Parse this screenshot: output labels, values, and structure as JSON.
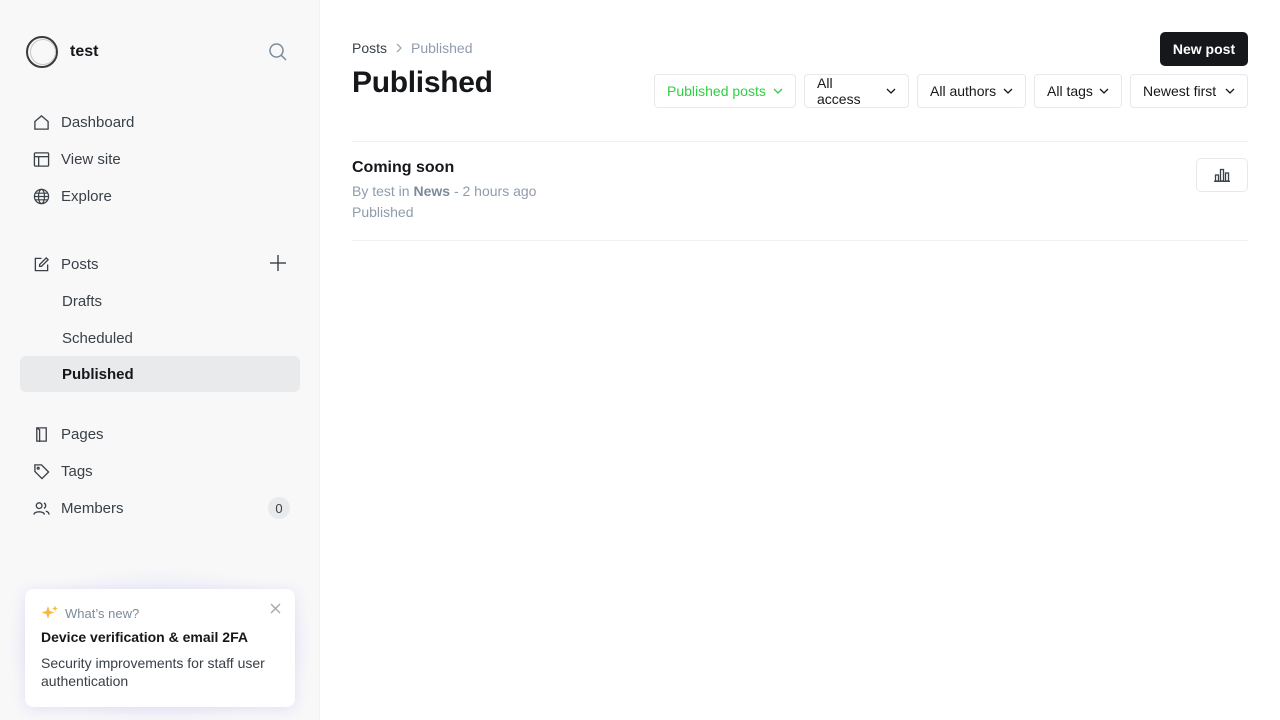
{
  "site": {
    "name": "test"
  },
  "sidebar": {
    "nav": [
      {
        "label": "Dashboard",
        "icon": "home-icon"
      },
      {
        "label": "View site",
        "icon": "layout-icon"
      },
      {
        "label": "Explore",
        "icon": "globe-icon"
      }
    ],
    "posts": {
      "label": "Posts",
      "icon": "edit-icon"
    },
    "post_subs": [
      {
        "label": "Drafts"
      },
      {
        "label": "Scheduled"
      },
      {
        "label": "Published",
        "active": true
      }
    ],
    "secondary": [
      {
        "label": "Pages",
        "icon": "page-icon"
      },
      {
        "label": "Tags",
        "icon": "tag-icon"
      },
      {
        "label": "Members",
        "icon": "members-icon",
        "count": "0"
      }
    ]
  },
  "whats_new": {
    "heading": "What’s new?",
    "title": "Device verification & email 2FA",
    "body": "Security improvements for staff user authentication"
  },
  "main": {
    "breadcrumb": {
      "parent": "Posts",
      "current": "Published"
    },
    "title": "Published",
    "new_post_label": "New post",
    "filters": {
      "type": "Published posts",
      "access": "All access",
      "authors": "All authors",
      "tags": "All tags",
      "order": "Newest first"
    },
    "posts": [
      {
        "title": "Coming soon",
        "by_prefix": "By test in",
        "tag": "News",
        "time": "- 2 hours ago",
        "status": "Published"
      }
    ]
  },
  "colors": {
    "accent_green": "#30cf43",
    "primary_dark": "#15171a",
    "muted": "#8e9cac",
    "sparkle": "#f6b73c"
  }
}
